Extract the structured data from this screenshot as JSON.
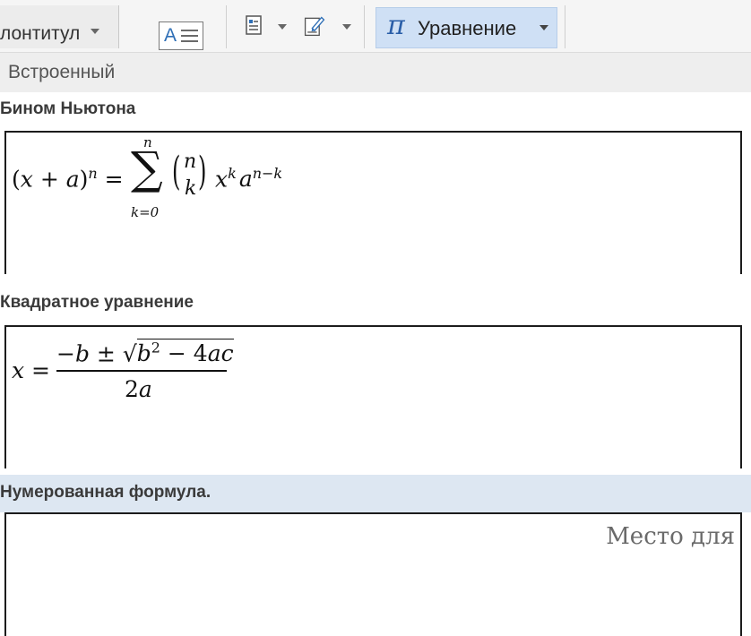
{
  "ribbon": {
    "header_footer_label": "лонтитул",
    "equation_label": "Уравнение",
    "equation_symbol": "π",
    "textbox_letter": "A"
  },
  "gallery": {
    "section_heading": "Встроенный",
    "items": [
      {
        "title": "Бином Ньютона",
        "formula": {
          "lhs_open": "(",
          "lhs_x": "x",
          "lhs_plus": " + ",
          "lhs_a": "a",
          "lhs_close": ")",
          "lhs_exp": "n",
          "equals": " = ",
          "sigma": "∑",
          "sum_upper": "n",
          "sum_lower": "k=0",
          "binom_open": "(",
          "binom_top": "n",
          "binom_bottom": "k",
          "binom_close": ")",
          "term_x": "x",
          "term_x_exp": "k",
          "term_a": "a",
          "term_a_exp": "n−k"
        }
      },
      {
        "title": "Квадратное уравнение",
        "formula": {
          "lhs": "x",
          "equals": " = ",
          "num_minus": "−",
          "num_b": "b",
          "num_pm": " ± ",
          "radical": "√",
          "rad_b": "b",
          "rad_b_exp": "2",
          "rad_minus": " − 4",
          "rad_ac": "ac",
          "den_2": "2",
          "den_a": "a"
        }
      },
      {
        "title": "Нумерованная формула.",
        "placeholder": "Место для"
      }
    ]
  },
  "colors": {
    "equation_button_bg": "#cfe0f5",
    "pi_color": "#2a5ea8",
    "highlight_bg": "#dde7f2"
  }
}
